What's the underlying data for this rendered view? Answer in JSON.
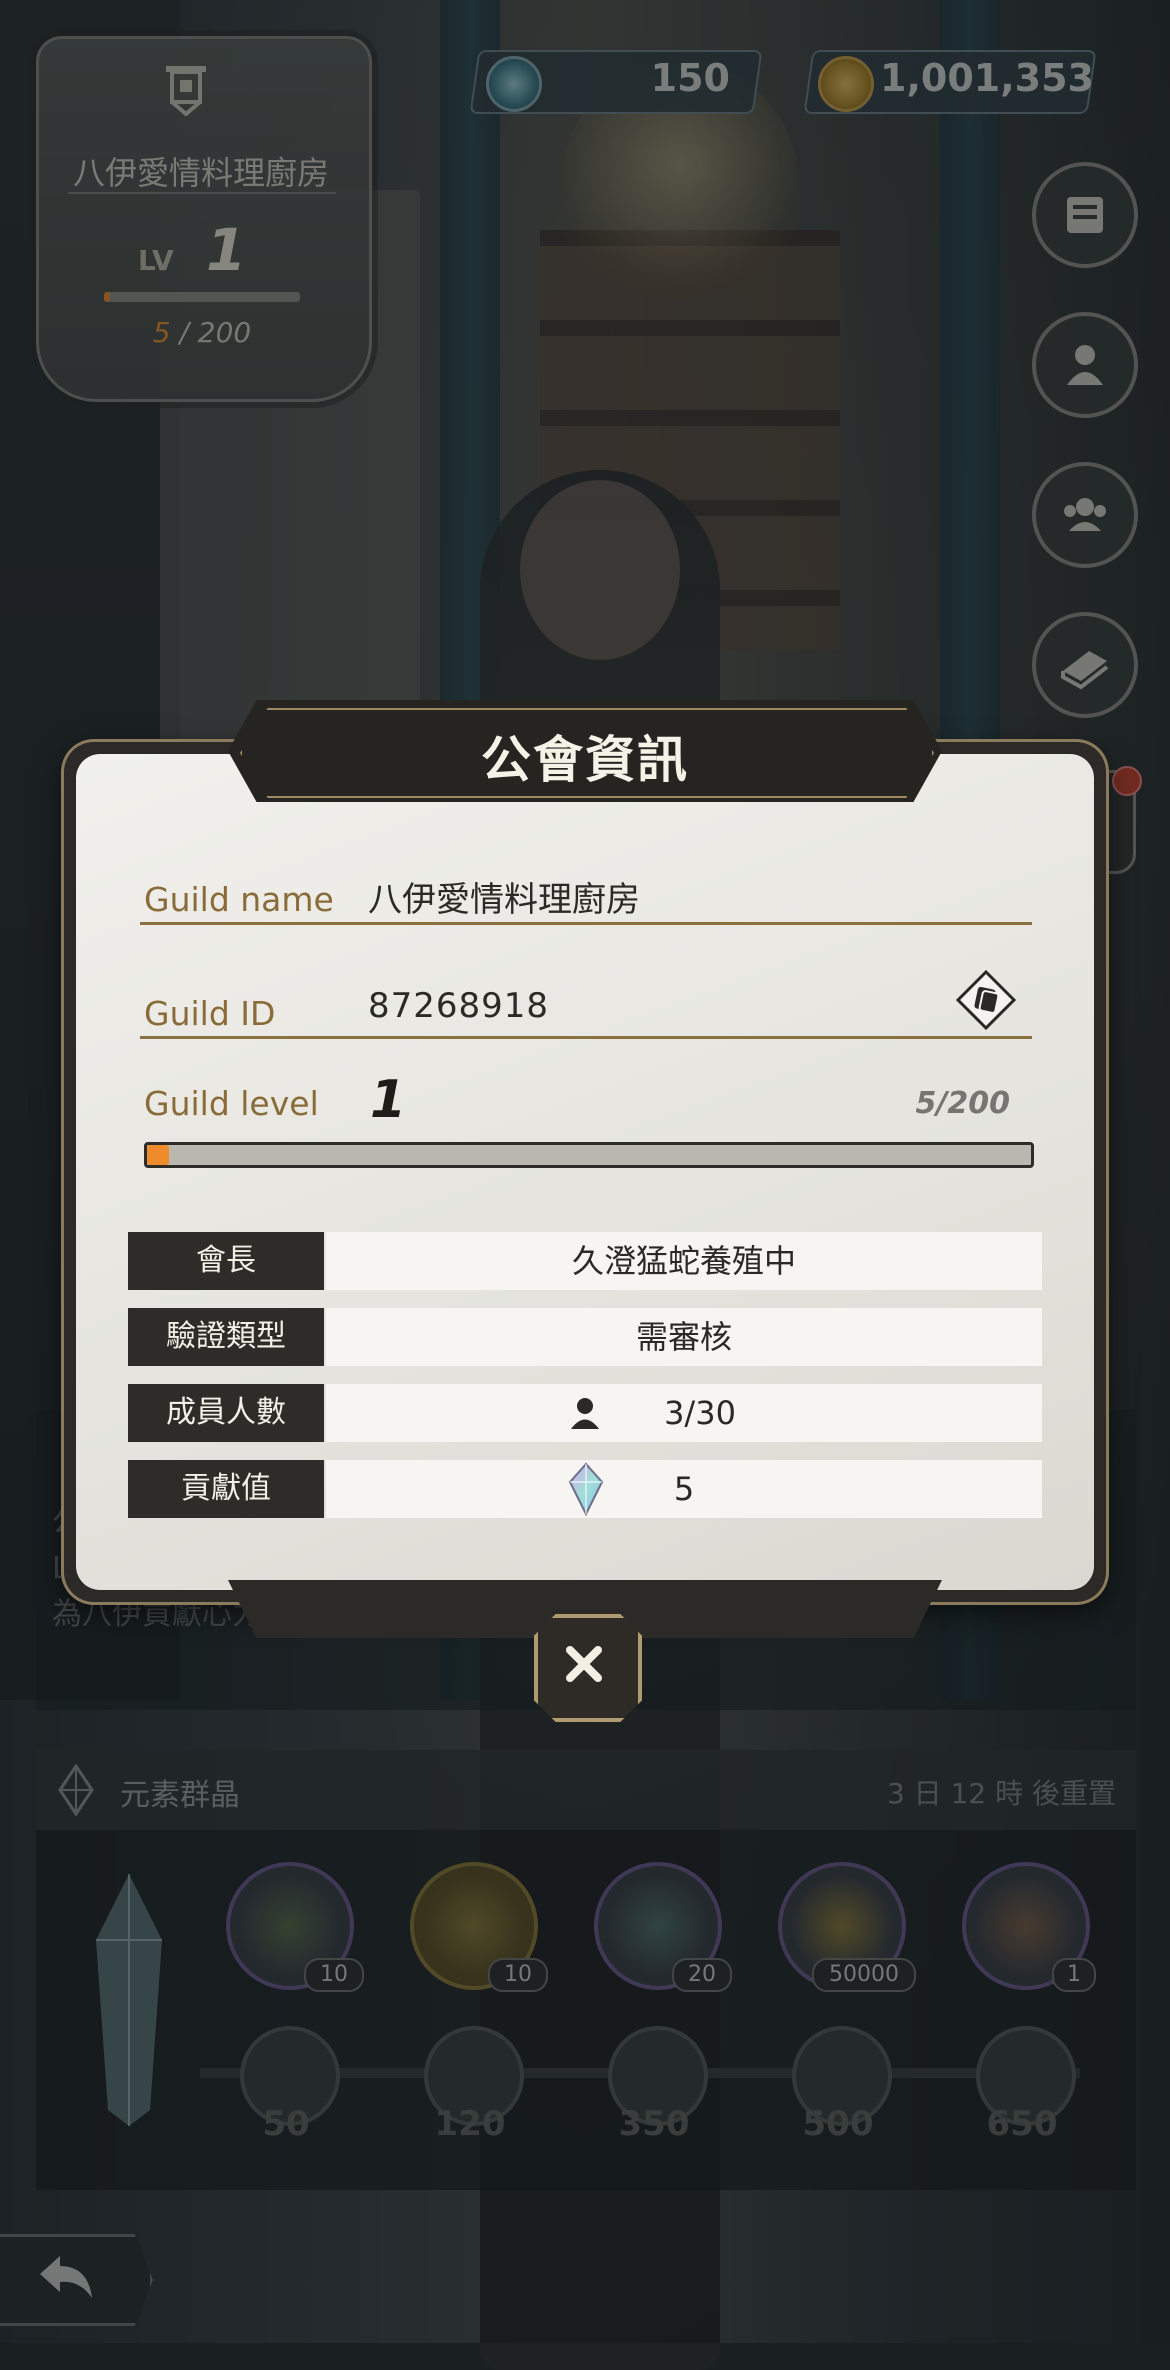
{
  "guild_badge": {
    "name": "八伊愛情料理廚房",
    "lv_label": "LV",
    "level": "1",
    "progress_current": "5",
    "progress_rest": " / 200",
    "progress_fraction": 0.025
  },
  "currencies": {
    "gems": "150",
    "coins": "1,001,353"
  },
  "side_buttons": [
    {
      "icon": "scroll-icon"
    },
    {
      "icon": "chef-icon"
    },
    {
      "icon": "members-icon"
    },
    {
      "icon": "book-icon"
    }
  ],
  "background_panel": {
    "announcement": "公告：八伊愛情料理廚房歡迎各位加入，一起努力拿活動獎勵吧～目前只收Lv50up戰鬥八伊阿確（？）超過三天未上線會直接踢除！希望阿確們可以一起為八伊貢獻心力哦～",
    "element_title": "元素群晶",
    "reset_text": "3 日 12 時 後重置",
    "rewards": [
      {
        "icon": "green-potion-icon",
        "count": "10"
      },
      {
        "icon": "gold-potion-icon",
        "count": "10"
      },
      {
        "icon": "ticket-icon",
        "count": "20"
      },
      {
        "icon": "gold-coin-icon",
        "count": "50000"
      },
      {
        "icon": "scroll-map-icon",
        "count": "1"
      }
    ],
    "milestones": [
      "50",
      "120",
      "350",
      "500",
      "650"
    ]
  },
  "modal": {
    "title": "公會資訊",
    "guild_name_label": "Guild name",
    "guild_name": "八伊愛情料理廚房",
    "guild_id_label": "Guild ID",
    "guild_id": "87268918",
    "guild_level_label": "Guild level",
    "guild_level": "1",
    "guild_level_progress": "5/200",
    "guild_level_fraction": 0.025,
    "rows": [
      {
        "label": "會長",
        "value": "久澄猛蛇養殖中"
      },
      {
        "label": "驗證類型",
        "value": "需審核"
      },
      {
        "label": "成員人數",
        "value": "3/30"
      },
      {
        "label": "貢獻值",
        "value": "5"
      }
    ]
  },
  "colors": {
    "accent_orange": "#ee8b2b",
    "label_gold": "#8a6c3a",
    "dark_panel": "#2e2c29"
  }
}
